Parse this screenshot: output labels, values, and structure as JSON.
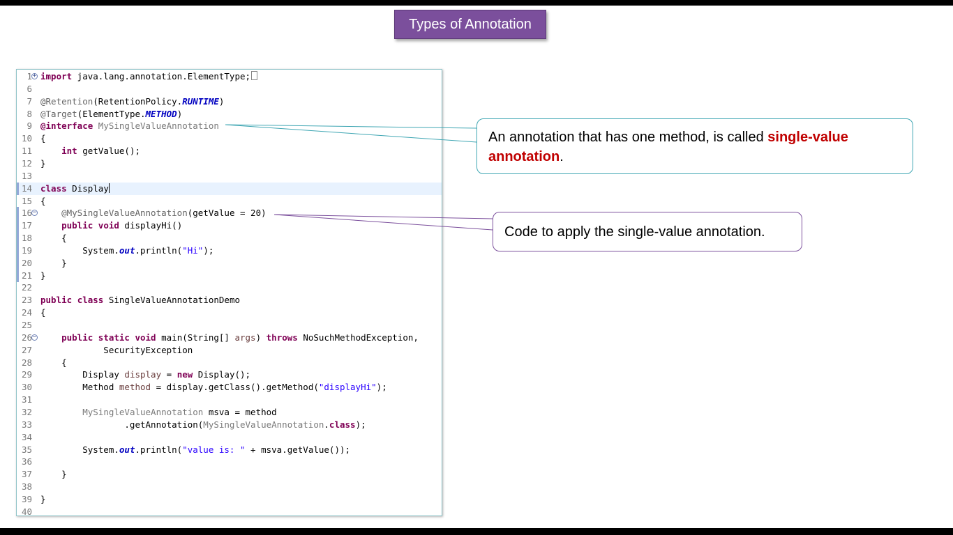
{
  "slide": {
    "title": "Types of Annotation"
  },
  "code_lines": [
    {
      "n": "1",
      "fold": "plus",
      "tokens": [
        {
          "t": "import",
          "c": "kw"
        },
        {
          "t": " java.lang.annotation.ElementType;"
        },
        {
          "t": "",
          "c": "box"
        }
      ]
    },
    {
      "n": "6",
      "tokens": []
    },
    {
      "n": "7",
      "tokens": [
        {
          "t": "@Retention",
          "c": "ann"
        },
        {
          "t": "(RetentionPolicy."
        },
        {
          "t": "RUNTIME",
          "c": "cn"
        },
        {
          "t": ")"
        }
      ]
    },
    {
      "n": "8",
      "tokens": [
        {
          "t": "@Target",
          "c": "ann"
        },
        {
          "t": "(ElementType."
        },
        {
          "t": "METHOD",
          "c": "cn"
        },
        {
          "t": ")"
        }
      ]
    },
    {
      "n": "9",
      "tokens": [
        {
          "t": "@interface",
          "c": "kw"
        },
        {
          "t": " "
        },
        {
          "t": "MySingleValueAnnotation",
          "c": "dim"
        }
      ]
    },
    {
      "n": "10",
      "tokens": [
        {
          "t": "{"
        }
      ]
    },
    {
      "n": "11",
      "tokens": [
        {
          "t": "    "
        },
        {
          "t": "int",
          "c": "kw"
        },
        {
          "t": " getValue();"
        }
      ]
    },
    {
      "n": "12",
      "tokens": [
        {
          "t": "}"
        }
      ]
    },
    {
      "n": "13",
      "tokens": []
    },
    {
      "n": "14",
      "hl": true,
      "marker": true,
      "tokens": [
        {
          "t": "class",
          "c": "kw"
        },
        {
          "t": " Display"
        },
        {
          "t": "",
          "c": "caret"
        }
      ]
    },
    {
      "n": "15",
      "tokens": [
        {
          "t": "{"
        }
      ]
    },
    {
      "n": "16",
      "fold": "minus",
      "marker": true,
      "tokens": [
        {
          "t": "    "
        },
        {
          "t": "@MySingleValueAnnotation",
          "c": "ann"
        },
        {
          "t": "(getValue = 20)"
        }
      ]
    },
    {
      "n": "17",
      "marker": true,
      "tokens": [
        {
          "t": "    "
        },
        {
          "t": "public",
          "c": "kw"
        },
        {
          "t": " "
        },
        {
          "t": "void",
          "c": "kw"
        },
        {
          "t": " displayHi()"
        }
      ]
    },
    {
      "n": "18",
      "marker": true,
      "tokens": [
        {
          "t": "    {"
        }
      ]
    },
    {
      "n": "19",
      "marker": true,
      "tokens": [
        {
          "t": "        System."
        },
        {
          "t": "out",
          "c": "fld"
        },
        {
          "t": ".println("
        },
        {
          "t": "\"Hi\"",
          "c": "st"
        },
        {
          "t": ");"
        }
      ]
    },
    {
      "n": "20",
      "marker": true,
      "tokens": [
        {
          "t": "    }"
        }
      ]
    },
    {
      "n": "21",
      "marker": true,
      "tokens": [
        {
          "t": "}"
        }
      ]
    },
    {
      "n": "22",
      "tokens": []
    },
    {
      "n": "23",
      "tokens": [
        {
          "t": "public",
          "c": "kw"
        },
        {
          "t": " "
        },
        {
          "t": "class",
          "c": "kw"
        },
        {
          "t": " SingleValueAnnotationDemo"
        }
      ]
    },
    {
      "n": "24",
      "tokens": [
        {
          "t": "{"
        }
      ]
    },
    {
      "n": "25",
      "tokens": []
    },
    {
      "n": "26",
      "fold": "minus",
      "tokens": [
        {
          "t": "    "
        },
        {
          "t": "public",
          "c": "kw"
        },
        {
          "t": " "
        },
        {
          "t": "static",
          "c": "kw"
        },
        {
          "t": " "
        },
        {
          "t": "void",
          "c": "kw"
        },
        {
          "t": " main(String[] "
        },
        {
          "t": "args",
          "c": "var"
        },
        {
          "t": ") "
        },
        {
          "t": "throws",
          "c": "kw"
        },
        {
          "t": " NoSuchMethodException,"
        }
      ]
    },
    {
      "n": "27",
      "tokens": [
        {
          "t": "            SecurityException"
        }
      ]
    },
    {
      "n": "28",
      "tokens": [
        {
          "t": "    {"
        }
      ]
    },
    {
      "n": "29",
      "tokens": [
        {
          "t": "        Display "
        },
        {
          "t": "display",
          "c": "var"
        },
        {
          "t": " = "
        },
        {
          "t": "new",
          "c": "kw"
        },
        {
          "t": " Display();"
        }
      ]
    },
    {
      "n": "30",
      "tokens": [
        {
          "t": "        Method "
        },
        {
          "t": "method",
          "c": "var"
        },
        {
          "t": " = display.getClass().getMethod("
        },
        {
          "t": "\"displayHi\"",
          "c": "st"
        },
        {
          "t": ");"
        }
      ]
    },
    {
      "n": "31",
      "tokens": []
    },
    {
      "n": "32",
      "tokens": [
        {
          "t": "        "
        },
        {
          "t": "MySingleValueAnnotation",
          "c": "dim"
        },
        {
          "t": " msva = method"
        }
      ]
    },
    {
      "n": "33",
      "tokens": [
        {
          "t": "                .getAnnotation("
        },
        {
          "t": "MySingleValueAnnotation",
          "c": "dim"
        },
        {
          "t": "."
        },
        {
          "t": "class",
          "c": "kw"
        },
        {
          "t": ");"
        }
      ]
    },
    {
      "n": "34",
      "tokens": []
    },
    {
      "n": "35",
      "tokens": [
        {
          "t": "        System."
        },
        {
          "t": "out",
          "c": "fld"
        },
        {
          "t": ".println("
        },
        {
          "t": "\"value is: \"",
          "c": "st"
        },
        {
          "t": " + msva.getValue());"
        }
      ]
    },
    {
      "n": "36",
      "tokens": []
    },
    {
      "n": "37",
      "tokens": [
        {
          "t": "    }"
        }
      ]
    },
    {
      "n": "38",
      "tokens": []
    },
    {
      "n": "39",
      "tokens": [
        {
          "t": "}"
        }
      ]
    },
    {
      "n": "40",
      "tokens": []
    }
  ],
  "callout1": {
    "before": "An annotation that has one method, is called ",
    "highlight": "single-value annotation",
    "after": ".",
    "border_color": "#3fa6b3"
  },
  "callout2": {
    "text": "Code to apply the single-value annotation.",
    "border_color": "#7b4f9c"
  },
  "colors": {
    "title_bg": "#7b4f9c",
    "keyword": "#7f0055",
    "string": "#2a00ff",
    "constant": "#0000c0",
    "annotation": "#646464",
    "highlight_text": "#c00000"
  }
}
